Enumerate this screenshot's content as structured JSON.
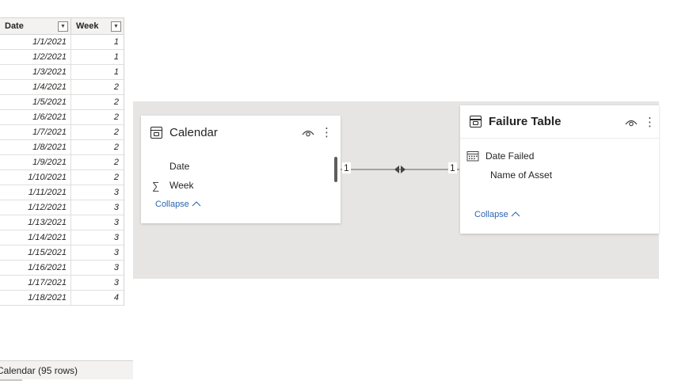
{
  "grid": {
    "headers": [
      "Date",
      "Week"
    ],
    "filter_glyph": "▼",
    "rows": [
      [
        "1/1/2021",
        "1"
      ],
      [
        "1/2/2021",
        "1"
      ],
      [
        "1/3/2021",
        "1"
      ],
      [
        "1/4/2021",
        "2"
      ],
      [
        "1/5/2021",
        "2"
      ],
      [
        "1/6/2021",
        "2"
      ],
      [
        "1/7/2021",
        "2"
      ],
      [
        "1/8/2021",
        "2"
      ],
      [
        "1/9/2021",
        "2"
      ],
      [
        "1/10/2021",
        "2"
      ],
      [
        "1/11/2021",
        "3"
      ],
      [
        "1/12/2021",
        "3"
      ],
      [
        "1/13/2021",
        "3"
      ],
      [
        "1/14/2021",
        "3"
      ],
      [
        "1/15/2021",
        "3"
      ],
      [
        "1/16/2021",
        "3"
      ],
      [
        "1/17/2021",
        "3"
      ],
      [
        "1/18/2021",
        "4"
      ]
    ],
    "footer": "Calendar (95 rows)"
  },
  "calendar_card": {
    "title": "Calendar",
    "fields": [
      {
        "name": "Date",
        "icon": ""
      },
      {
        "name": "Week",
        "icon": "∑"
      }
    ],
    "collapse": "Collapse"
  },
  "failure_card": {
    "title": "Failure Table",
    "fields": [
      {
        "name": "Date Failed",
        "icon": "calendar-icon"
      },
      {
        "name": "Name of Asset",
        "icon": ""
      }
    ],
    "collapse": "Collapse"
  },
  "relationship": {
    "left_cardinality": "1",
    "right_cardinality": "1",
    "direction": "both"
  },
  "colors": {
    "canvas": "#e6e5e4",
    "link": "#2b66b1"
  }
}
